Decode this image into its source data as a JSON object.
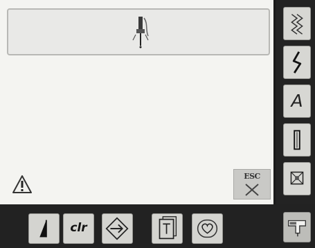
{
  "message_box": {
    "icon": "needle-threading-icon"
  },
  "alert": {
    "icon": "warning-icon"
  },
  "esc_button": {
    "label": "ESC",
    "icon": "close-icon"
  },
  "sidebar": {
    "items": [
      {
        "name": "practical-stitches",
        "icon": "zigzag-icon"
      },
      {
        "name": "decorative-stitches",
        "icon": "lightning-stitch-icon"
      },
      {
        "name": "alphabets",
        "label": "A"
      },
      {
        "name": "buttonholes",
        "icon": "buttonhole-icon"
      },
      {
        "name": "quilt-stitches",
        "icon": "grid-icon"
      }
    ]
  },
  "bottom_bar": {
    "items": [
      {
        "name": "balance",
        "icon": "wedge-icon"
      },
      {
        "name": "clear",
        "label": "clr"
      },
      {
        "name": "memory",
        "icon": "diamond-arrow-icon"
      },
      {
        "name": "tutorial",
        "icon": "book-icon"
      },
      {
        "name": "favorite",
        "icon": "heart-icon"
      }
    ],
    "setup_icon": "sewing-machine-icon"
  },
  "colors": {
    "panel_bg": "#f4f4f1",
    "button_bg": "#d4d4d0",
    "frame_bg": "#232323"
  }
}
